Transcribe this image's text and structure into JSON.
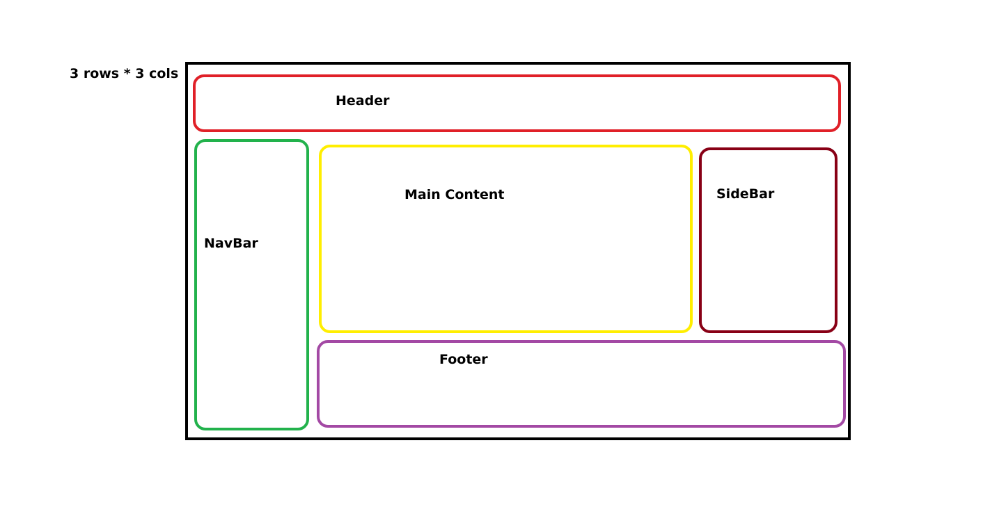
{
  "caption": "3 rows * 3 cols",
  "regions": {
    "header": {
      "label": "Header",
      "color": "#e02028"
    },
    "navbar": {
      "label": "NavBar",
      "color": "#22b24c"
    },
    "main": {
      "label": "Main Content",
      "color": "#ffee00"
    },
    "sidebar": {
      "label": "SideBar",
      "color": "#880015"
    },
    "footer": {
      "label": "Footer",
      "color": "#a349a4"
    }
  },
  "frame_color": "#000000"
}
